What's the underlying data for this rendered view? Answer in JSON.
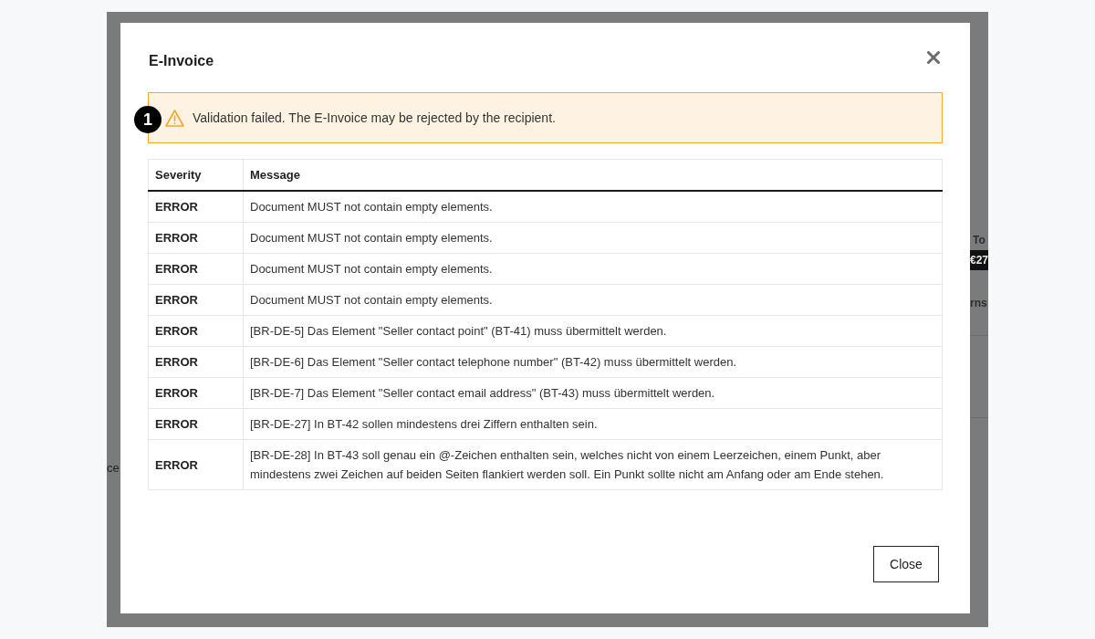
{
  "background": {
    "left_fragments": [
      "ce"
    ],
    "right_fragments": [
      {
        "kind": "label",
        "text": "To"
      },
      {
        "kind": "chip",
        "text": "€27"
      },
      {
        "kind": "label",
        "text": "rns"
      }
    ]
  },
  "dialog": {
    "title": "E-Invoice",
    "alert": {
      "kind": "warning",
      "text": "Validation failed. The E-Invoice may be rejected by the recipient."
    },
    "annotation_marker": "1",
    "table": {
      "columns": [
        "Severity",
        "Message"
      ],
      "rows": [
        {
          "severity": "ERROR",
          "message": "Document MUST not contain empty elements."
        },
        {
          "severity": "ERROR",
          "message": "Document MUST not contain empty elements."
        },
        {
          "severity": "ERROR",
          "message": "Document MUST not contain empty elements."
        },
        {
          "severity": "ERROR",
          "message": "Document MUST not contain empty elements."
        },
        {
          "severity": "ERROR",
          "message": "[BR-DE-5] Das Element \"Seller contact point\" (BT-41) muss übermittelt werden."
        },
        {
          "severity": "ERROR",
          "message": "[BR-DE-6] Das Element \"Seller contact telephone number\" (BT-42) muss übermittelt werden."
        },
        {
          "severity": "ERROR",
          "message": "[BR-DE-7] Das Element \"Seller contact email address\" (BT-43) muss übermittelt werden."
        },
        {
          "severity": "ERROR",
          "message": "[BR-DE-27] In BT-42 sollen mindestens drei Ziffern enthalten sein."
        },
        {
          "severity": "ERROR",
          "message": "[BR-DE-28] In BT-43 soll genau ein @-Zeichen enthalten sein, welches nicht von einem Leerzeichen, einem Punkt, aber mindestens zwei Zeichen auf beiden Seiten flankiert werden soll. Ein Punkt sollte nicht am Anfang oder am Ende stehen."
        }
      ]
    },
    "footer_button": "Close"
  }
}
